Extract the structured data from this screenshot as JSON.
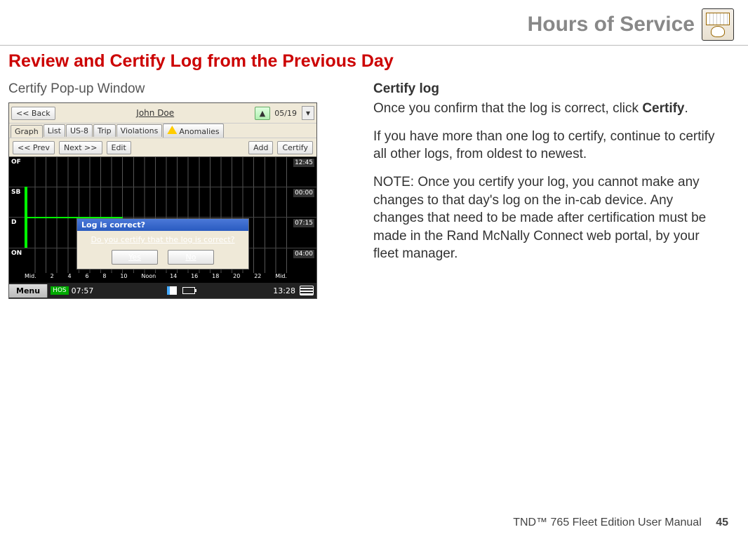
{
  "header": {
    "title": "Hours of Service"
  },
  "page_title": "Review and Certify Log from the Previous Day",
  "left": {
    "caption": "Certify Pop-up Window"
  },
  "device": {
    "back_btn": "<< Back",
    "driver_name": "John Doe",
    "date": "05/19",
    "tabs": {
      "graph": "Graph",
      "list": "List",
      "us8": "US-8",
      "trip": "Trip",
      "violations": "Violations",
      "anomalies": "Anomalies"
    },
    "prev_btn": "<< Prev",
    "next_btn": "Next >>",
    "edit_btn": "Edit",
    "add_btn": "Add",
    "certify_btn": "Certify",
    "graph_rows": {
      "of": {
        "label": "OF",
        "value": "12:45"
      },
      "sb": {
        "label": "SB",
        "value": "00:00"
      },
      "d": {
        "label": "D",
        "value": "07:15"
      },
      "on": {
        "label": "ON",
        "value": "04:00"
      }
    },
    "xaxis": {
      "mid_l": "Mid.",
      "t2": "2",
      "t4": "4",
      "t6": "6",
      "t8": "8",
      "t10": "10",
      "noon": "Noon",
      "t14": "14",
      "t16": "16",
      "t18": "18",
      "t20": "20",
      "t22": "22",
      "mid_r": "Mid."
    },
    "popup": {
      "title": "Log is correct?",
      "question": "Do you certify that the log is correct?",
      "yes": "Yes",
      "no": "No"
    },
    "status": {
      "menu": "Menu",
      "hos": "HOS",
      "time1": "07:57",
      "time2": "13:28"
    }
  },
  "right": {
    "heading": "Certify log",
    "para1_a": "Once you confirm that the log is correct, click ",
    "para1_bold": "Certify",
    "para1_b": ".",
    "para2": "If you have more than one log to certify, continue to certify all other logs, from oldest to newest.",
    "para3": "NOTE: Once you certify your log, you cannot make any changes to that day's log on the in-cab device. Any changes that need to be made after certification must be made in the Rand McNally Connect web portal, by your fleet manager."
  },
  "footer": {
    "text": "TND™ 765 Fleet Edition User Manual",
    "page": "45"
  }
}
